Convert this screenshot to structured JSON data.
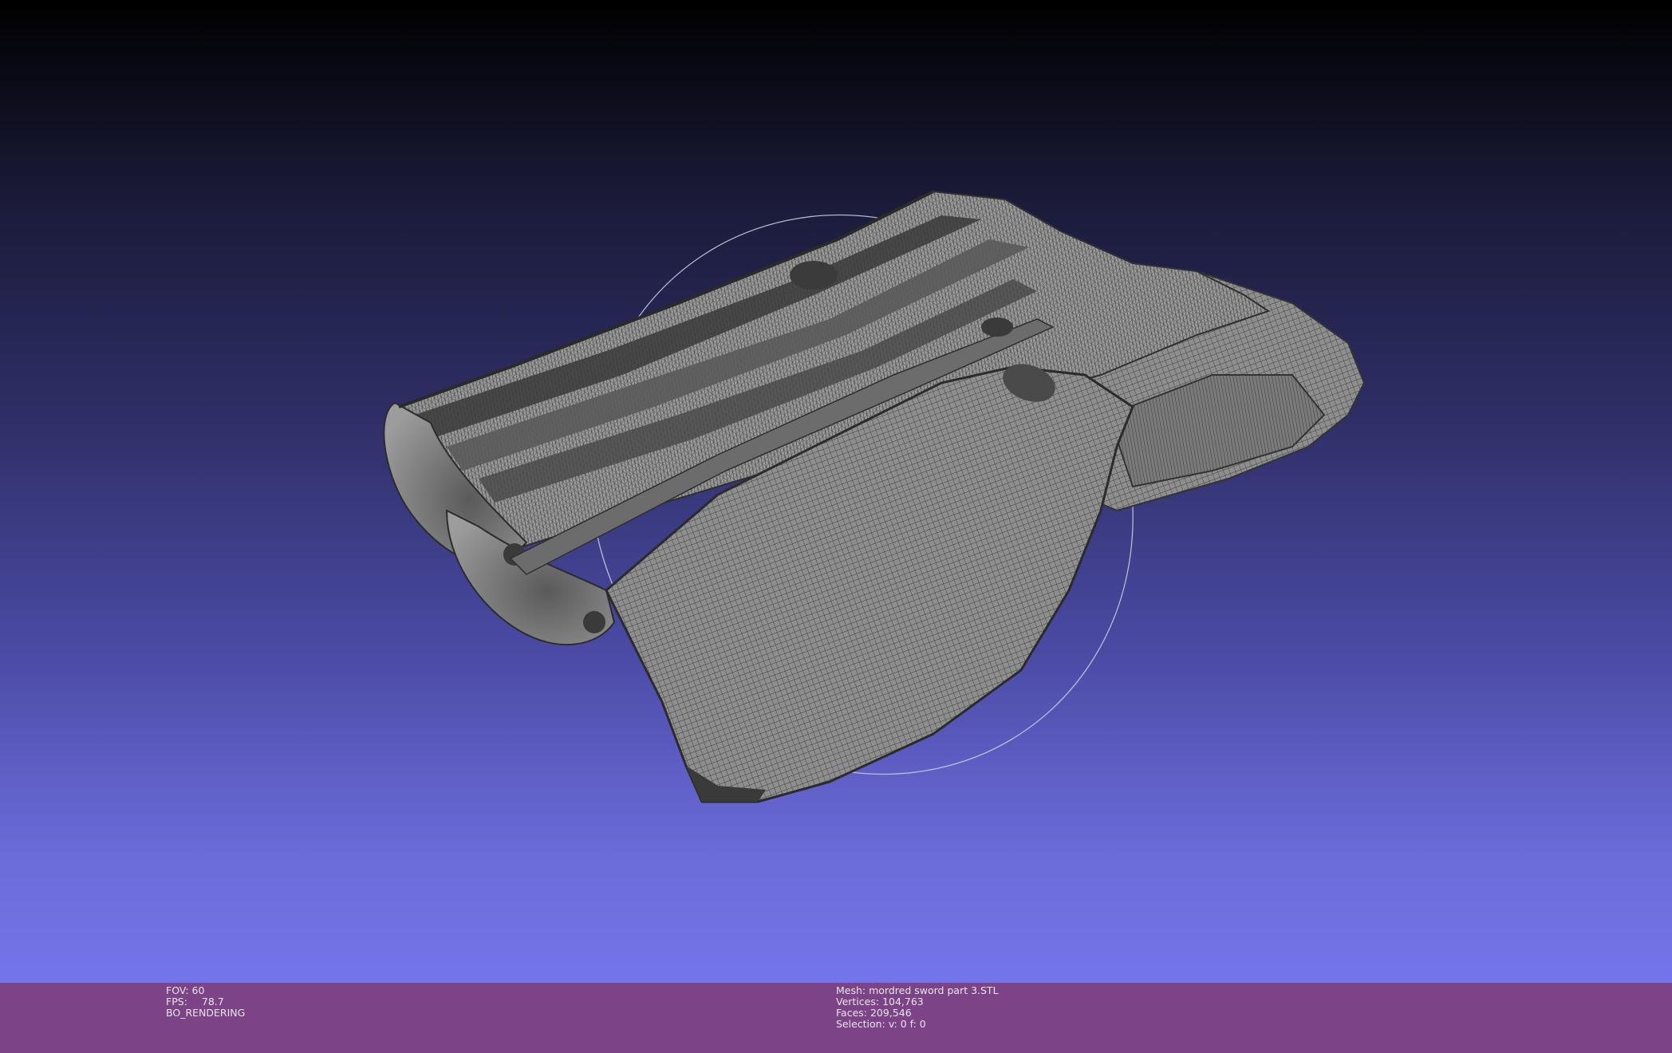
{
  "viewer": {
    "object_icon": "3d-wireframe-mesh"
  },
  "info_left": {
    "fov_label": "FOV:",
    "fov_value": "60",
    "fps_label": "FPS:",
    "fps_value": "78.7",
    "render_mode": "BO_RENDERING"
  },
  "info_right": {
    "mesh_label": "Mesh:",
    "mesh_name": "mordred sword part 3.STL",
    "vertices_label": "Vertices:",
    "vertices_value": "104,763",
    "faces_label": "Faces:",
    "faces_value": "209,546",
    "selection_label": "Selection:",
    "selection_value": "v: 0 f: 0"
  },
  "colors": {
    "statusbar": "#7d4387",
    "mesh_fill": "#8c8c8c",
    "mesh_edge": "#3c3c3c"
  }
}
